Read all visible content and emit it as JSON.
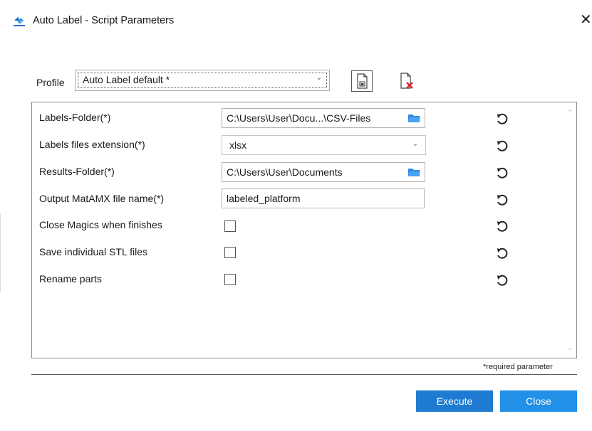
{
  "window": {
    "title": "Auto Label - Script Parameters",
    "close_glyph": "✕",
    "icon": "magics-logo-icon"
  },
  "profile": {
    "label": "Profile",
    "selected": "Auto Label default *",
    "save_icon": "save-profile-icon",
    "delete_icon": "delete-profile-icon"
  },
  "params": [
    {
      "label": "Labels-Folder(*)",
      "type": "folder",
      "value": "C:\\Users\\User\\Docu...\\CSV-Files"
    },
    {
      "label": "Labels files extension(*)",
      "type": "select",
      "value": "xlsx"
    },
    {
      "label": "Results-Folder(*)",
      "type": "folder",
      "value": "C:\\Users\\User\\Documents"
    },
    {
      "label": "Output MatAMX file name(*)",
      "type": "text",
      "value": "labeled_platform"
    },
    {
      "label": "Close Magics when finishes",
      "type": "checkbox",
      "checked": false
    },
    {
      "label": "Save individual STL files",
      "type": "checkbox",
      "checked": false
    },
    {
      "label": "Rename parts",
      "type": "checkbox",
      "checked": false
    }
  ],
  "footer": {
    "required_note": "*required parameter",
    "execute_label": "Execute",
    "close_label": "Close"
  },
  "colors": {
    "primary_button": "#1e7bd1",
    "folder_icon": "#2b8be0",
    "delete_red": "#d9262c"
  }
}
